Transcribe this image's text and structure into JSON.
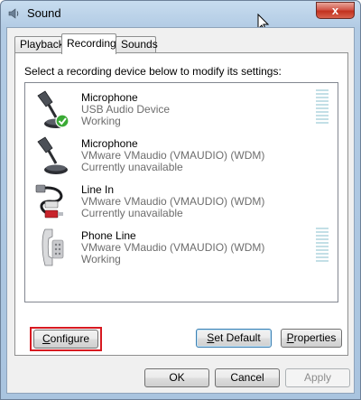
{
  "window": {
    "title": "Sound",
    "close_label": "x"
  },
  "tabs": [
    {
      "label": "Playback"
    },
    {
      "label": "Recording"
    },
    {
      "label": "Sounds"
    }
  ],
  "recording": {
    "instruction": "Select a recording device below to modify its settings:",
    "devices": [
      {
        "name": "Microphone",
        "driver": "USB Audio Device",
        "status": "Working",
        "icon": "microphone-icon",
        "default_check": true,
        "meter": true
      },
      {
        "name": "Microphone",
        "driver": "VMware VMaudio (VMAUDIO) (WDM)",
        "status": "Currently unavailable",
        "icon": "microphone-icon",
        "meter": false
      },
      {
        "name": "Line In",
        "driver": "VMware VMaudio (VMAUDIO) (WDM)",
        "status": "Currently unavailable",
        "icon": "audio-cable-icon",
        "meter": false
      },
      {
        "name": "Phone Line",
        "driver": "VMware VMaudio (VMAUDIO) (WDM)",
        "status": "Working",
        "icon": "telephone-icon",
        "meter": true
      }
    ],
    "buttons": {
      "configure": {
        "first": "C",
        "rest": "onfigure"
      },
      "set_default": {
        "first": "S",
        "rest": "et Default"
      },
      "properties": {
        "first": "P",
        "rest": "roperties"
      }
    }
  },
  "footer": {
    "ok": "OK",
    "cancel": "Cancel",
    "apply": "Apply"
  },
  "colors": {
    "highlight": "#d71920",
    "meter": "#c3dfe6",
    "close_red": "#c2321f"
  }
}
